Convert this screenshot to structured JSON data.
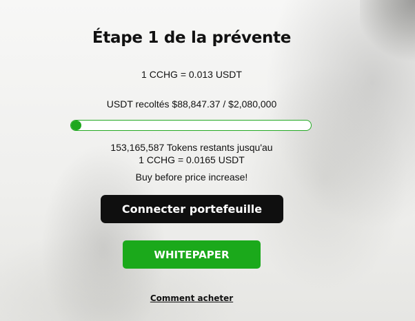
{
  "presale": {
    "title": "Étape 1 de la prévente",
    "current_price": "1 CCHG = 0.013 USDT",
    "raised_label": "USDT recoltés $88,847.37 / $2,080,000",
    "progress_fraction": 0.0427,
    "tokens_remaining": "153,165,587 Tokens restants jusqu'au",
    "next_price": "1 CCHG = 0.0165 USDT",
    "notice": "Buy before price increase!"
  },
  "actions": {
    "connect_label": "Connecter portefeuille",
    "whitepaper_label": "WHITEPAPER",
    "how_to_buy_label": "Comment acheter"
  },
  "colors": {
    "accent": "#1ba91b",
    "dark_button": "#0f0f0f"
  }
}
